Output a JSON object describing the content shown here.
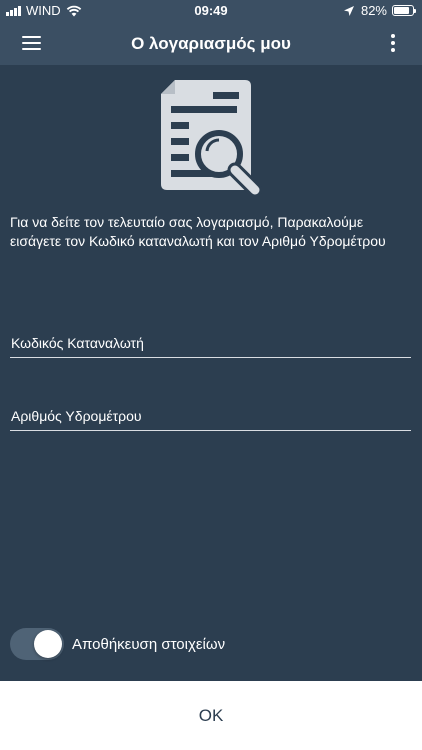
{
  "status_bar": {
    "carrier": "WIND",
    "time": "09:49",
    "battery_percent": "82%",
    "battery_level": 0.82,
    "icons": [
      "signal-icon",
      "wifi-icon",
      "location-arrow-icon",
      "battery-icon"
    ]
  },
  "app_bar": {
    "title": "Ο λογαριασμός μου",
    "menu_icon": "hamburger-menu-icon",
    "more_icon": "more-vertical-icon"
  },
  "main": {
    "illustration_icon": "document-search-icon",
    "instructions": "Για να δείτε τον τελευταίο σας λογαριασμό, Παρακαλούμε εισάγετε τον Κωδικό καταναλωτή και τον Αριθμό Υδρομέτρου",
    "consumer_code": {
      "placeholder": "Κωδικός Καταναλωτή",
      "value": ""
    },
    "meter_number": {
      "placeholder": "Αριθμός Υδρομέτρου",
      "value": ""
    },
    "save_toggle": {
      "label": "Αποθήκευση στοιχείων",
      "on": true
    }
  },
  "footer": {
    "ok_label": "OK"
  },
  "colors": {
    "background": "#2c3e50",
    "app_bar": "#3b4f63",
    "toggle_track": "#4f6376",
    "text": "#ffffff"
  }
}
